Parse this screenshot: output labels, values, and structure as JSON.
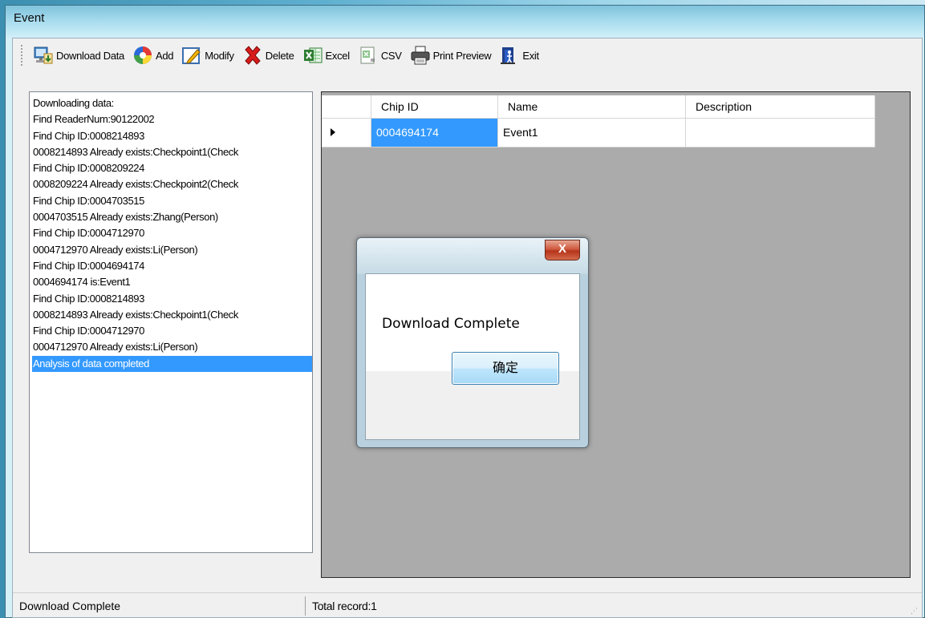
{
  "window": {
    "title": "Event"
  },
  "toolbar": {
    "download": "Download Data",
    "add": "Add",
    "modify": "Modify",
    "delete": "Delete",
    "excel": "Excel",
    "csv": "CSV",
    "print_preview": "Print Preview",
    "exit": "Exit"
  },
  "log": {
    "lines": [
      "Downloading data:",
      "Find ReaderNum:90122002",
      "Find Chip ID:0008214893",
      "0008214893 Already exists:Checkpoint1(Check",
      "Find Chip ID:0008209224",
      "0008209224 Already exists:Checkpoint2(Check",
      "Find Chip ID:0004703515",
      "0004703515 Already exists:Zhang(Person)",
      "Find Chip ID:0004712970",
      "0004712970 Already exists:Li(Person)",
      "Find Chip ID:0004694174",
      "0004694174 is:Event1",
      "Find Chip ID:0008214893",
      "0008214893 Already exists:Checkpoint1(Check",
      "Find Chip ID:0004712970",
      "0004712970 Already exists:Li(Person)",
      "Analysis of data completed"
    ]
  },
  "grid": {
    "columns": [
      "Chip ID",
      "Name",
      "Description"
    ],
    "rows": [
      {
        "chip_id": "0004694174",
        "name": "Event1",
        "description": ""
      }
    ]
  },
  "dialog": {
    "close_glyph": "X",
    "message": "Download Complete",
    "ok_label": "确定"
  },
  "status": {
    "left": "Download Complete",
    "right": "Total record:1"
  }
}
